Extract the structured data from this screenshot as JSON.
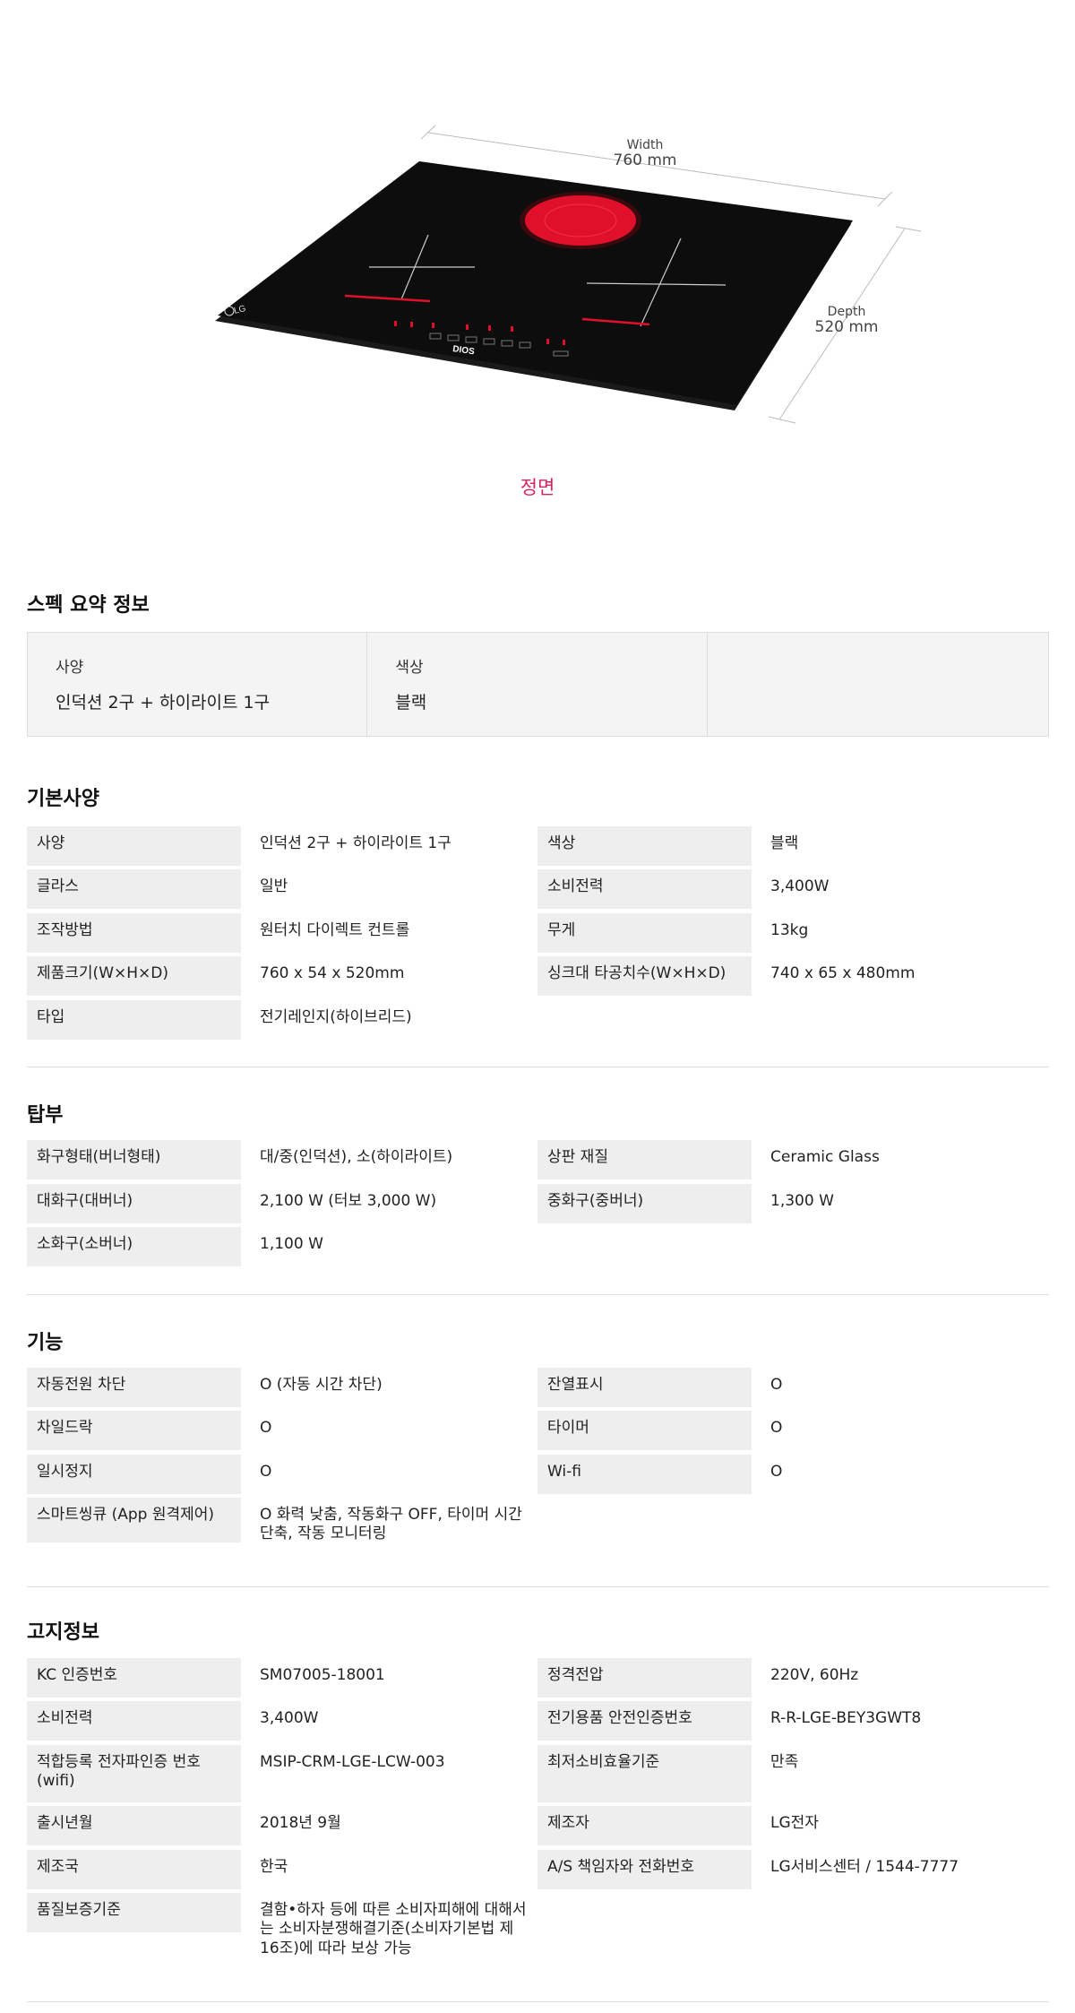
{
  "hero": {
    "width_label": "Width",
    "width_value": "760 mm",
    "depth_label": "Depth",
    "depth_value": "520 mm",
    "brand_logo_text": "LG",
    "model_badge_text": "DIOS",
    "caption": "정면",
    "colors": {
      "cooktop": "#0d0d0d",
      "burner": "#e0102a",
      "caption": "#d6245e"
    }
  },
  "summary": {
    "title": "스펙 요약 정보",
    "items": [
      {
        "label": "사양",
        "value": "인덕션 2구 + 하이라이트 1구"
      },
      {
        "label": "색상",
        "value": "블랙"
      }
    ]
  },
  "sections": [
    {
      "title": "기본사양",
      "rows": [
        [
          {
            "key": "사양",
            "value": "인덕션 2구 + 하이라이트 1구"
          },
          {
            "key": "색상",
            "value": "블랙"
          }
        ],
        [
          {
            "key": "글라스",
            "value": "일반"
          },
          {
            "key": "소비전력",
            "value": "3,400W"
          }
        ],
        [
          {
            "key": "조작방법",
            "value": "원터치 다이렉트 컨트롤"
          },
          {
            "key": "무게",
            "value": "13kg"
          }
        ],
        [
          {
            "key": "제품크기(W×H×D)",
            "value": "760 x 54 x 520mm"
          },
          {
            "key": "싱크대 타공치수(W×H×D)",
            "value": "740 x 65 x 480mm"
          }
        ],
        [
          {
            "key": "타입",
            "value": "전기레인지(하이브리드)"
          }
        ]
      ]
    },
    {
      "title": "탑부",
      "rows": [
        [
          {
            "key": "화구형태(버너형태)",
            "value": "대/중(인덕션), 소(하이라이트)"
          },
          {
            "key": "상판 재질",
            "value": "Ceramic Glass"
          }
        ],
        [
          {
            "key": "대화구(대버너)",
            "value": "2,100 W (터보 3,000 W)"
          },
          {
            "key": "중화구(중버너)",
            "value": "1,300 W"
          }
        ],
        [
          {
            "key": "소화구(소버너)",
            "value": "1,100 W"
          }
        ]
      ]
    },
    {
      "title": "기능",
      "rows": [
        [
          {
            "key": "자동전원 차단",
            "value": "O  (자동 시간 차단)"
          },
          {
            "key": "잔열표시",
            "value": "O"
          }
        ],
        [
          {
            "key": "차일드락",
            "value": "O"
          },
          {
            "key": "타이머",
            "value": "O"
          }
        ],
        [
          {
            "key": "일시정지",
            "value": "O"
          },
          {
            "key": "Wi-fi",
            "value": "O"
          }
        ],
        [
          {
            "key": "스마트씽큐 (App 원격제어)",
            "value": "O  화력 낮춤, 작동화구 OFF, 타이머 시간 단축, 작동 모니터링"
          }
        ]
      ]
    },
    {
      "title": "고지정보",
      "rows": [
        [
          {
            "key": "KC 인증번호",
            "value": "SM07005-18001"
          },
          {
            "key": "정격전압",
            "value": "220V, 60Hz"
          }
        ],
        [
          {
            "key": "소비전력",
            "value": "3,400W"
          },
          {
            "key": "전기용품 안전인증번호",
            "value": "R-R-LGE-BEY3GWT8"
          }
        ],
        [
          {
            "key": "적합등록 전자파인증 번호 (wifi)",
            "value": "MSIP-CRM-LGE-LCW-003"
          },
          {
            "key": "최저소비효율기준",
            "value": "만족"
          }
        ],
        [
          {
            "key": "출시년월",
            "value": "2018년 9월"
          },
          {
            "key": "제조자",
            "value": "LG전자"
          }
        ],
        [
          {
            "key": "제조국",
            "value": "한국"
          },
          {
            "key": "A/S 책임자와 전화번호",
            "value": "LG서비스센터 / 1544-7777"
          }
        ],
        [
          {
            "key": "품질보증기준",
            "value": "결함•하자 등에 따른 소비자피해에 대해서는 소비자분쟁해결기준(소비자기본법 제16조)에 따라 보상 가능"
          }
        ]
      ]
    }
  ]
}
